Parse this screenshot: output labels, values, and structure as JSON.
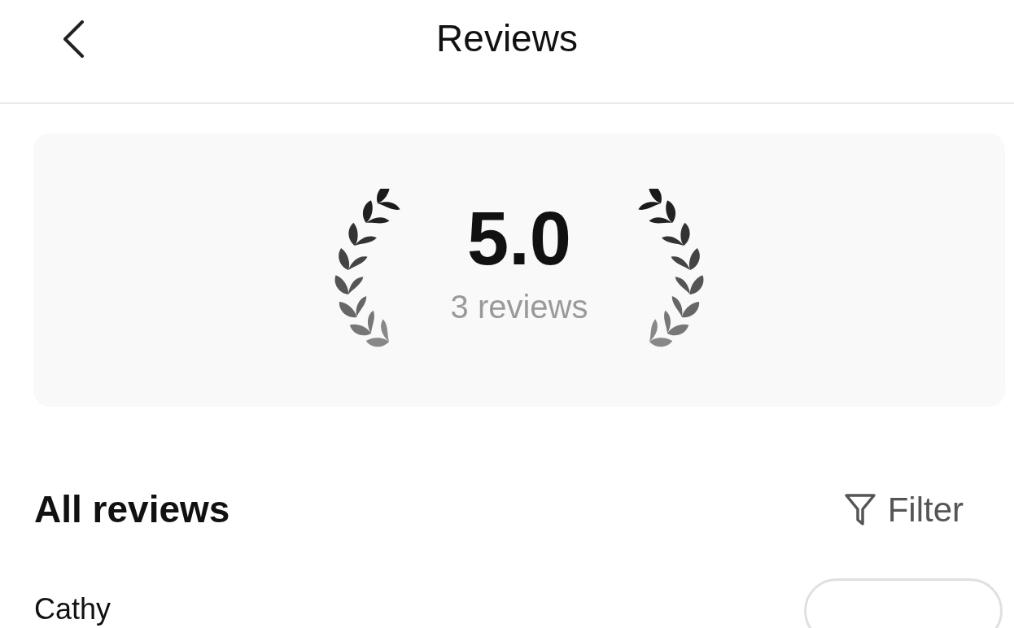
{
  "header": {
    "title": "Reviews"
  },
  "summary": {
    "rating": "5.0",
    "count": "3 reviews"
  },
  "section": {
    "title": "All reviews",
    "filter": "Filter"
  },
  "reviews": [
    {
      "name": "Cathy"
    }
  ]
}
